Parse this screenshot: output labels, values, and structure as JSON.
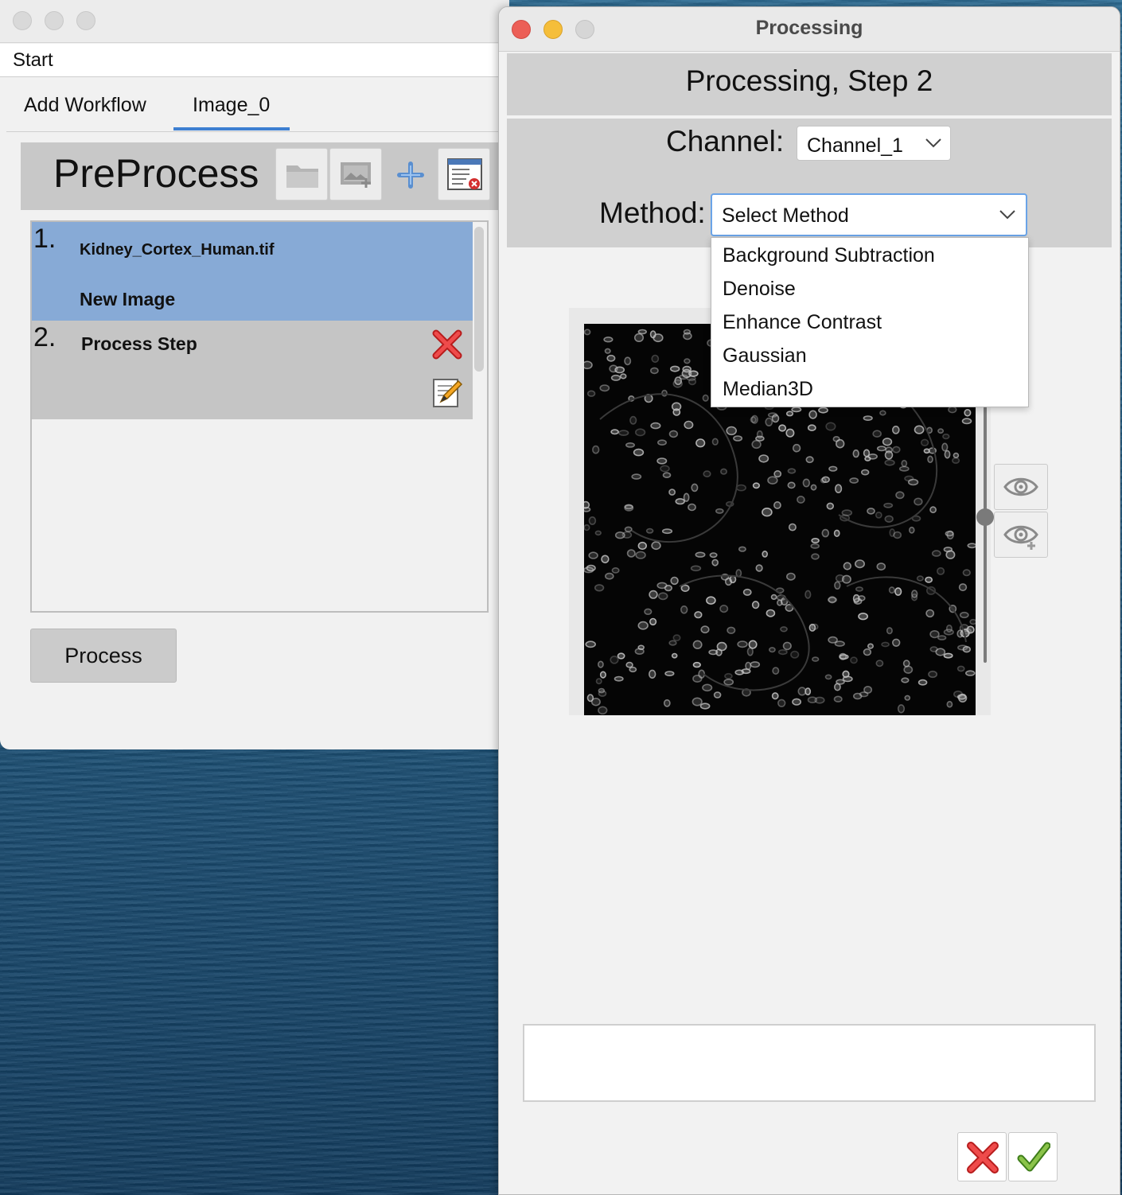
{
  "main_window": {
    "menubar": {
      "start": "Start"
    },
    "tabs": [
      {
        "label": "Add Workflow"
      },
      {
        "label": "Image_0"
      }
    ],
    "preprocess": {
      "title": "PreProcess",
      "toolbar_icons": [
        "folder-icon",
        "image-import-icon",
        "add-icon",
        "delete-workflow-icon"
      ]
    },
    "steps": [
      {
        "number": "1.",
        "file": "Kidney_Cortex_Human.tif",
        "label": "New Image"
      },
      {
        "number": "2.",
        "label": "Process Step"
      }
    ],
    "process_button": "Process",
    "colors": {
      "selected_step": "#87aad6",
      "tab_underline": "#3d7fd1"
    }
  },
  "processing_dialog": {
    "title": "Processing",
    "step_header": "Processing, Step 2",
    "channel": {
      "label": "Channel:",
      "value": "Channel_1"
    },
    "method": {
      "label": "Method:",
      "value": "Select Method",
      "options": [
        "Background Subtraction",
        "Denoise",
        "Enhance Contrast",
        "Gaussian",
        "Median3D"
      ]
    },
    "side_icons": [
      "eye-icon",
      "eye-add-icon"
    ],
    "footer_icons": [
      "cancel-icon",
      "confirm-icon"
    ]
  }
}
